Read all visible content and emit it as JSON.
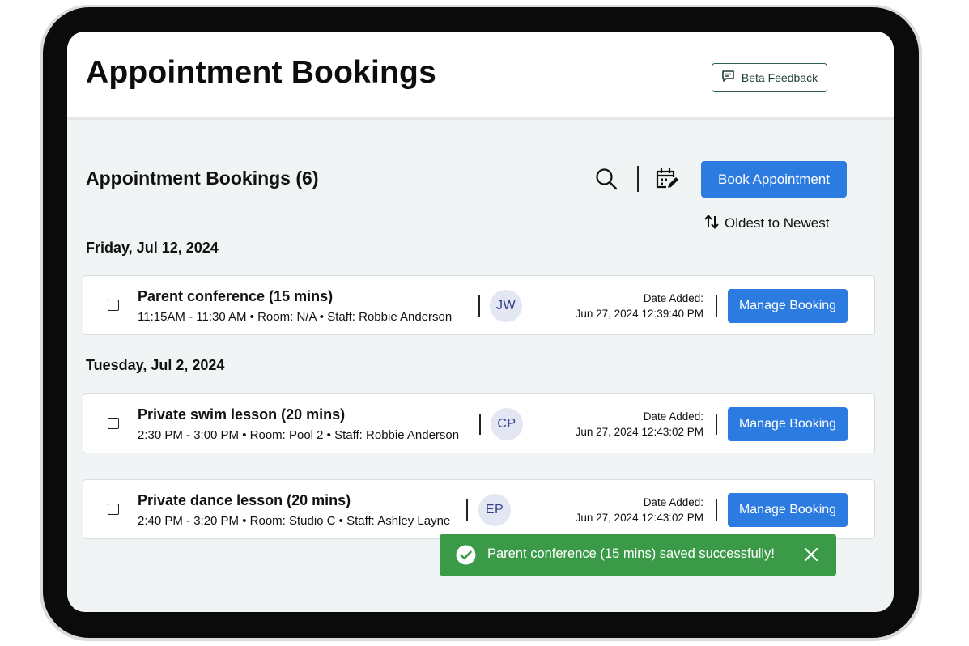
{
  "header": {
    "title": "Appointment Bookings",
    "beta_feedback_label": "Beta Feedback"
  },
  "toolbar": {
    "section_title": "Appointment Bookings (6)",
    "book_label": "Book Appointment",
    "sort_label": "Oldest to Newest",
    "icons": [
      "search-icon",
      "calendar-edit-icon",
      "sort-arrows-icon"
    ]
  },
  "groups": [
    {
      "date": "Friday, Jul 12, 2024",
      "bookings": [
        {
          "title": "Parent conference (15 mins)",
          "details": "11:15AM - 11:30 AM • Room: N/A • Staff: Robbie Anderson",
          "initials": "JW",
          "date_added_label": "Date Added:",
          "date_added": "Jun 27, 2024 12:39:40 PM",
          "manage_label": "Manage Booking"
        }
      ]
    },
    {
      "date": "Tuesday, Jul 2, 2024",
      "bookings": [
        {
          "title": "Private swim lesson (20 mins)",
          "details": "2:30 PM - 3:00 PM • Room: Pool 2 • Staff: Robbie Anderson",
          "initials": "CP",
          "date_added_label": "Date Added:",
          "date_added": "Jun 27, 2024 12:43:02 PM",
          "manage_label": "Manage Booking"
        },
        {
          "title": "Private dance lesson (20 mins)",
          "details": "2:40 PM - 3:20 PM • Room: Studio C • Staff: Ashley Layne",
          "initials": "EP",
          "date_added_label": "Date Added:",
          "date_added": "Jun 27, 2024 12:43:02 PM",
          "manage_label": "Manage Booking"
        }
      ]
    }
  ],
  "toast": {
    "message": "Parent conference (15 mins) saved successfully!",
    "color": "#3b9a48"
  },
  "colors": {
    "primary": "#2c7be0",
    "avatar_bg": "#e3e6f3",
    "avatar_text": "#33408a",
    "success": "#3b9a48"
  }
}
